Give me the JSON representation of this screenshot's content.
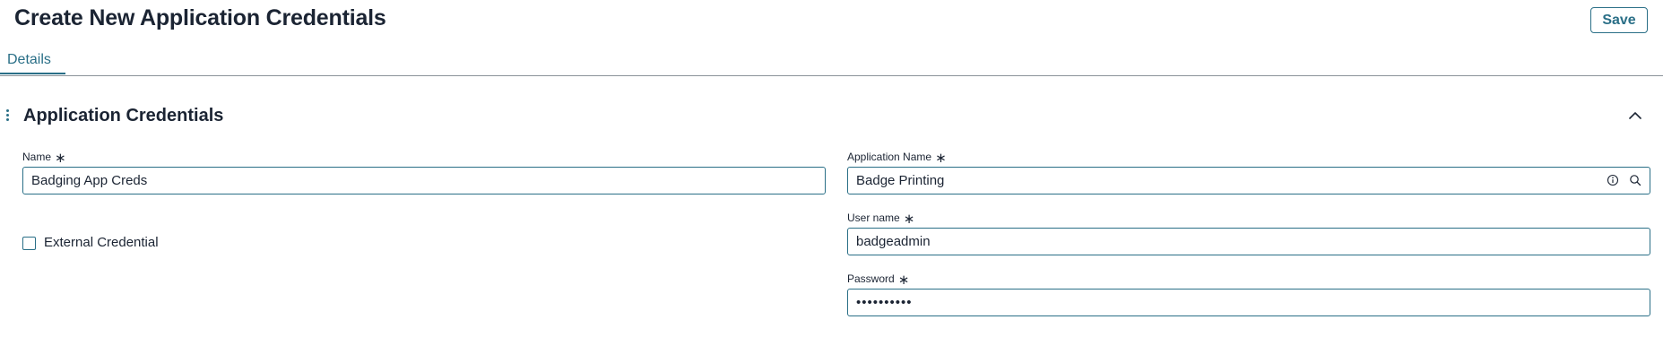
{
  "header": {
    "title": "Create New Application Credentials",
    "save_label": "Save"
  },
  "tabs": [
    {
      "label": "Details",
      "active": true
    }
  ],
  "section": {
    "title": "Application Credentials",
    "collapse_icon": "chevron-up-icon",
    "drag_icon": "drag-handle-icon"
  },
  "fields": {
    "name": {
      "label": "Name",
      "required_mark": "∗",
      "value": "Badging App Creds"
    },
    "application_name": {
      "label": "Application Name",
      "required_mark": "∗",
      "value": "Badge Printing",
      "icons": [
        "info-icon",
        "search-icon"
      ]
    },
    "external_credential": {
      "label": "External Credential",
      "checked": false
    },
    "user_name": {
      "label": "User name",
      "required_mark": "∗",
      "value": "badgeadmin"
    },
    "password": {
      "label": "Password",
      "required_mark": "∗",
      "value": "••••••••••"
    }
  },
  "colors": {
    "accent": "#2a6f87",
    "text": "#1b2433",
    "divider": "#8a9299"
  }
}
